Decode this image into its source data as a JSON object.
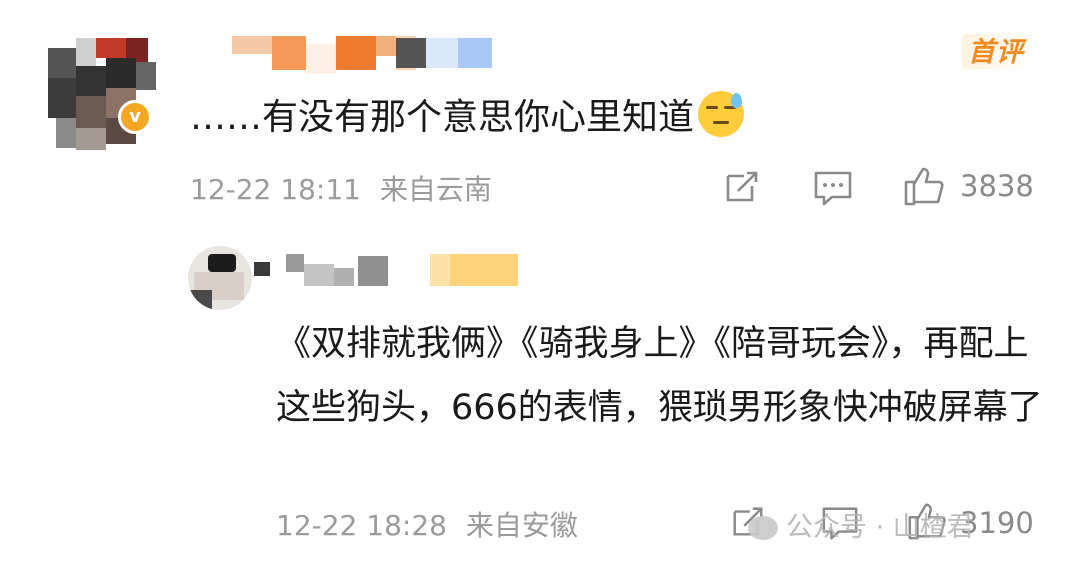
{
  "comment1": {
    "badge": "首评",
    "text": "……有没有那个意思你心里知道",
    "emoji": "downcast-sweat-emoji",
    "date": "12-22 18:11",
    "location": "来自云南",
    "like_count": "3838"
  },
  "comment2": {
    "text": "《双排就我俩》《骑我身上》《陪哥玩会》，再配上这些狗头，666的表情，猥琐男形象快冲破屏幕了",
    "date": "12-22 18:28",
    "location": "来自安徽",
    "like_count": "3190"
  },
  "watermark": "公众号 · 山楂君",
  "colors": {
    "accent": "#f28a1e",
    "meta": "#9b9b9b",
    "text": "#1a1a1a",
    "verified": "#f5a623"
  }
}
